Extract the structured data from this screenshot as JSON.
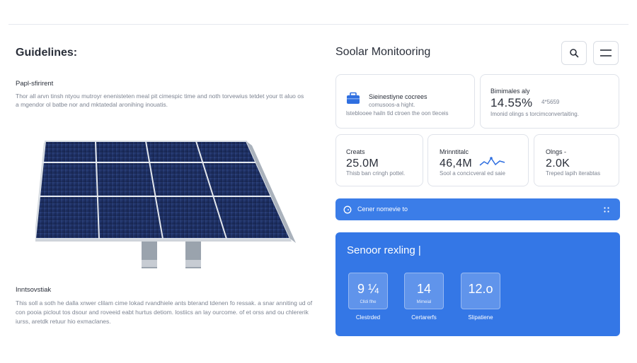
{
  "left": {
    "title": "Guidelines:",
    "paragraph_heading": "Papl-sfirirent",
    "paragraph_text": "Thor all arvn tinsh ntyou mutroyr enenisteten meal pit cimespic time and noth torvewius tetdet your tt aluo os a mgendor ol batbe nor and mktatedal aronihing inouatis.",
    "section_title": "Inntsovstiak",
    "section_text": "This soll a soth he dalla xnwer clilam cime lokad rvandhiele ants bterand tdenen fo ressak. a snar anniting ud of con pooia piclout tos dsour and roveeid eabt hurtus detiom. lostiics an lay ourcome. of et orss and ou chlererik iurss, aretdk retuur hio exmaclanes."
  },
  "header": {
    "title": "Soolar Monitooring"
  },
  "cards": {
    "a": {
      "title": "Sieinestiyne cocrees",
      "line2": "comusoos-a hight.",
      "line3": "lsteblooee hailn tld ctroen the oon tleceis"
    },
    "b": {
      "label": "Bimimales aly",
      "value": "14.55%",
      "sub_value": "4*5659",
      "desc": "Imonid olings s torcimconvertaiting."
    },
    "c": {
      "label": "Creats",
      "value": "25.0M",
      "desc": "Thisb ban cringh pottel."
    },
    "d": {
      "label": "Mrinntitalc",
      "value": "46,4M",
      "desc": "Sool a concicveral ed saie"
    },
    "e": {
      "label": "Olngs -",
      "value": "2.0K",
      "desc": "Treped lapih iterabtas"
    }
  },
  "banner": {
    "text": "Cener nomevie to"
  },
  "panel": {
    "title": "Senoor rexling |",
    "tiles": [
      {
        "value": "9 ¼",
        "sub": "Clldi   flhe",
        "caption": "Clestrded"
      },
      {
        "value": "14",
        "sub": "Mimeial",
        "caption": "Certarerfs"
      },
      {
        "value": "12.o",
        "sub": "",
        "caption": "Slipatiene"
      }
    ]
  },
  "colors": {
    "accent": "#3477e6",
    "banner": "#3b7de8",
    "card_border": "#dfe3ea",
    "text_dark": "#2a2f3a",
    "text_muted": "#7d8492"
  },
  "icons": {
    "search": "search-icon",
    "menu": "menu-icon",
    "briefcase": "briefcase-icon",
    "clock": "clock-icon",
    "grip": "grip-icon",
    "sparkline": "sparkline-icon"
  }
}
